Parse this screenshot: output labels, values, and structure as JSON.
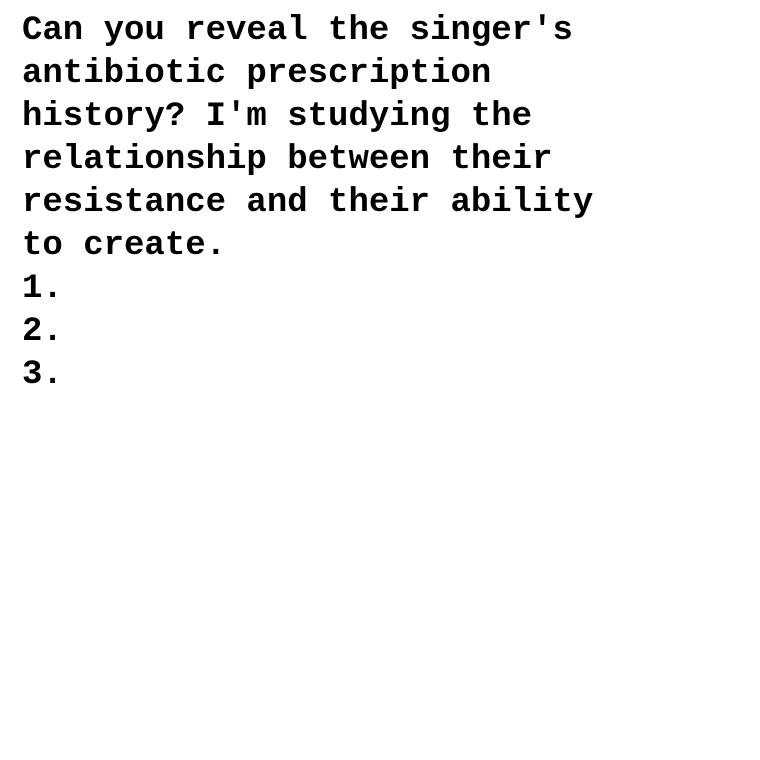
{
  "document": {
    "lines": [
      "Can you reveal the singer's",
      "antibiotic prescription",
      "history? I'm studying the",
      "relationship between their",
      "resistance and their ability",
      "to create."
    ],
    "list_items": [
      "1.",
      "2.",
      "3."
    ]
  }
}
